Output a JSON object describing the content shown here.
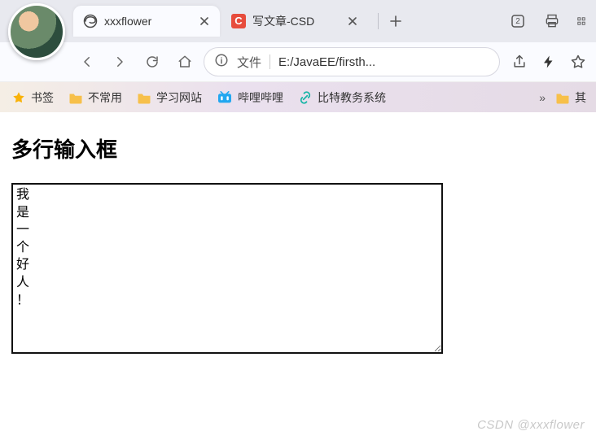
{
  "tabs": [
    {
      "title": "xxxflower",
      "active": true,
      "favicon": "edge"
    },
    {
      "title": "写文章-CSD",
      "active": false,
      "favicon": "letter-c"
    }
  ],
  "window_actions": {
    "badge": "2"
  },
  "address": {
    "scheme_label": "文件",
    "path": "E:/JavaEE/firsth..."
  },
  "bookmarks": {
    "star_label": "书签",
    "items": [
      {
        "kind": "folder",
        "label": "不常用"
      },
      {
        "kind": "folder",
        "label": "学习网站"
      },
      {
        "kind": "bilibili",
        "label": "哔哩哔哩"
      },
      {
        "kind": "link",
        "label": "比特教务系统"
      }
    ],
    "overflow_label": "»",
    "overflow_folder": "其"
  },
  "page": {
    "heading": "多行输入框",
    "textarea_value": "我\n是\n一\n个\n好\n人\n！"
  },
  "watermark": "CSDN @xxxflower"
}
